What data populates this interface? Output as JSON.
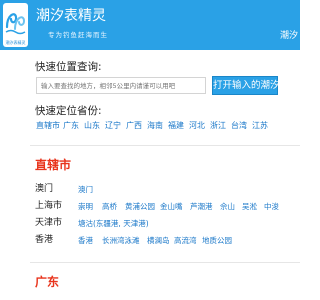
{
  "header": {
    "logo_text": "潮汐表精灵",
    "title": "潮汐表精灵",
    "slogan": "专为钓鱼赶海而生",
    "nav_right": "潮汐"
  },
  "search": {
    "label": "快速位置查询:",
    "placeholder": "输入要查找的地方，相邻5公里内请谨可以用吧",
    "button_label": "打开输入的潮汐"
  },
  "province": {
    "label": "快速定位省份:",
    "items": [
      "直辖市",
      "广东",
      "山东",
      "辽宁",
      "广西",
      "海南",
      "福建",
      "河北",
      "浙江",
      "台湾",
      "江苏"
    ]
  },
  "sections": [
    {
      "title": "直辖市",
      "cities": [
        {
          "name": "澳门",
          "spots": [
            "澳门"
          ]
        },
        {
          "name": "上海市",
          "spots": [
            "崇明",
            "高桥",
            "黄浦公园",
            "金山嘴",
            "芦潮港",
            "佘山",
            "吴淞",
            "中浚"
          ]
        },
        {
          "name": "天津市",
          "spots": [
            "塘沽(东疆港, 天津港)"
          ]
        },
        {
          "name": "香港",
          "spots": [
            "香港",
            "长洲湾泳滩",
            "横澜岛",
            "高流湾",
            "地质公园"
          ]
        }
      ]
    },
    {
      "title": "广东",
      "cities": []
    }
  ],
  "colors": {
    "accent": "#2aa1e6",
    "link": "#1b78c9",
    "section_title": "#e8341c"
  }
}
